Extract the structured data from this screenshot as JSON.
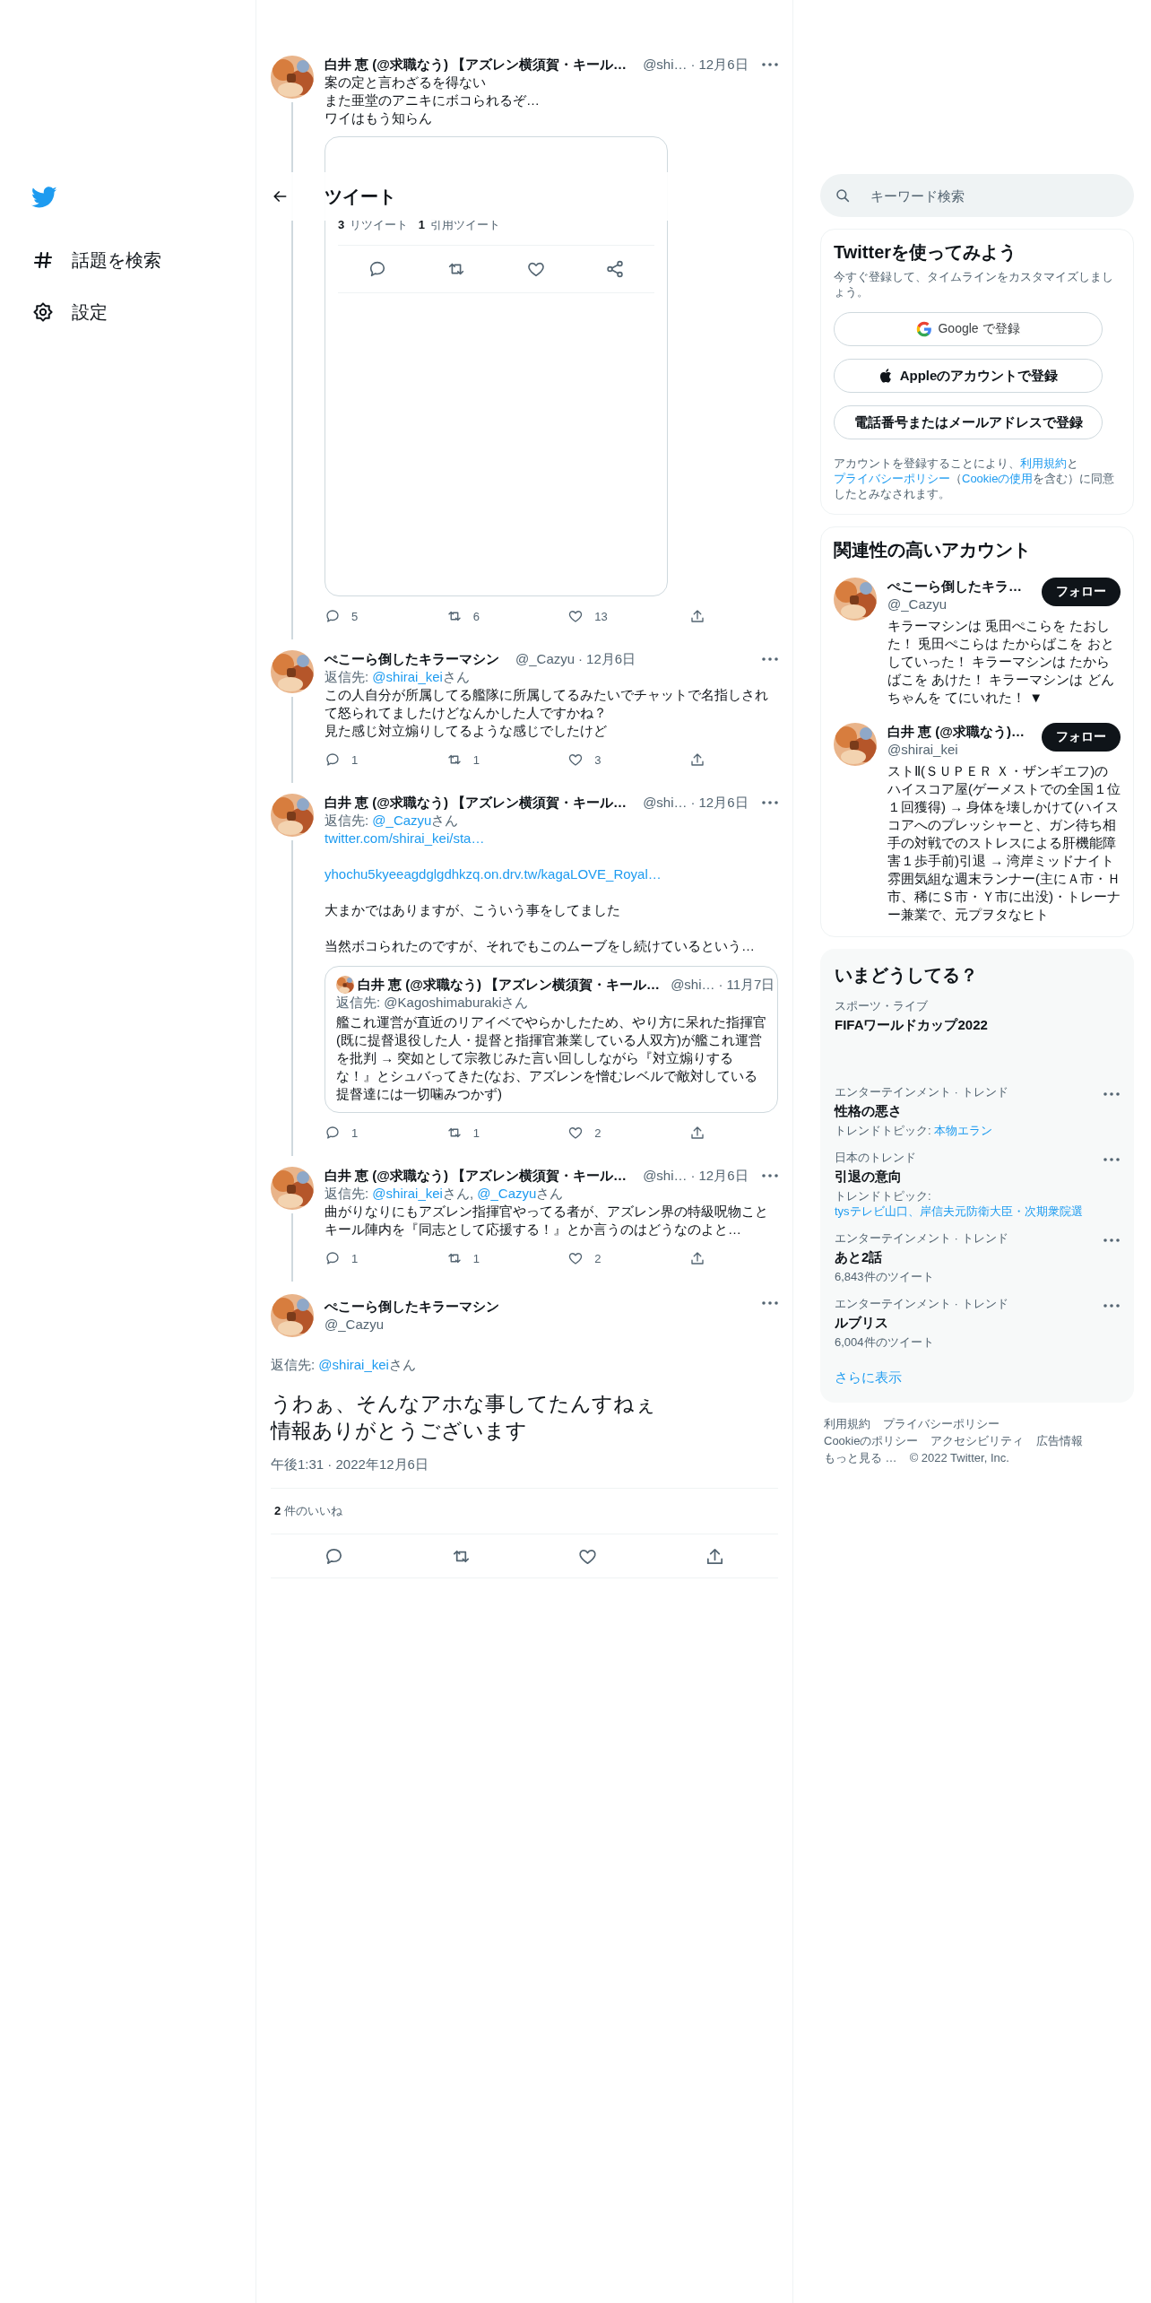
{
  "nav": {
    "items": [
      {
        "kind": "explore",
        "label": "話題を検索"
      },
      {
        "kind": "settings",
        "label": "設定"
      }
    ]
  },
  "header": {
    "title": "ツイート"
  },
  "thread": [
    {
      "name": "白井 恵 (@求職なう) 【アズレン横須賀・キール…",
      "handle": "@shi…",
      "dot": "·",
      "date": "12月6日",
      "body": [
        {
          "kind": "text",
          "lines": [
            "案の定と言わざるを得ない",
            "また亜堂のアニキにボコられるぞ…",
            "ワイはもう知らん"
          ]
        }
      ],
      "media": {
        "stats": [
          {
            "count": "3",
            "label": "リツイート"
          },
          {
            "count": "1",
            "label": "引用ツイート"
          }
        ]
      },
      "counts": {
        "reply": "5",
        "retweet": "6",
        "like": "13"
      }
    },
    {
      "name": "ぺこーら倒したキラーマシン",
      "handle": "@_Cazyu",
      "dot": "·",
      "date": "12月6日",
      "reply": [
        {
          "kind": "text",
          "text": "返信先: "
        },
        {
          "kind": "link",
          "text": "@shirai_kei"
        },
        {
          "kind": "text",
          "text": "さん"
        }
      ],
      "body": [
        {
          "kind": "text",
          "lines": [
            "この人自分が所属してる艦隊に所属してるみたいでチャットで名指しされて怒られてましたけどなんかした人ですかね？",
            "見た感じ対立煽りしてるような感じでしたけど"
          ]
        }
      ],
      "counts": {
        "reply": "1",
        "retweet": "1",
        "like": "3"
      }
    },
    {
      "name": "白井 恵 (@求職なう) 【アズレン横須賀・キール…",
      "handle": "@shi…",
      "dot": "·",
      "date": "12月6日",
      "reply": [
        {
          "kind": "text",
          "text": "返信先: "
        },
        {
          "kind": "link",
          "text": "@_Cazyu"
        },
        {
          "kind": "text",
          "text": "さん"
        }
      ],
      "body": [
        {
          "kind": "link",
          "lines": [
            "twitter.com/shirai_kei/sta…"
          ]
        },
        {
          "kind": "link",
          "lines": [
            "yhochu5kyeeagdglgdhkzq.on.drv.tw/kagaLOVE_Royal…"
          ]
        },
        {
          "kind": "text",
          "lines": [
            "大まかではありますが、こういう事をしてました"
          ]
        },
        {
          "kind": "text",
          "lines": [
            "当然ボコられたのですが、それでもこのムーブをし続けているという…"
          ]
        }
      ],
      "quote": {
        "name": "白井 恵 (@求職なう) 【アズレン横須賀・キール…",
        "handle": "@shi…",
        "dot": "·",
        "date": "11月7日",
        "reply": "返信先: @Kagoshimaburakiさん",
        "text": "艦これ運営が直近のリアイベでやらかしたため、やり方に呆れた指揮官(既に提督退役した人・提督と指揮官兼業している人双方)が艦これ運営を批判 → 突如として宗教じみた言い回ししながら『対立煽りするな！』とシュバってきた(なお、アズレンを憎むレベルで敵対している提督達には一切噛みつかず)"
      },
      "counts": {
        "reply": "1",
        "retweet": "1",
        "like": "2"
      }
    },
    {
      "name": "白井 恵 (@求職なう) 【アズレン横須賀・キール…",
      "handle": "@shi…",
      "dot": "·",
      "date": "12月6日",
      "reply": [
        {
          "kind": "text",
          "text": "返信先: "
        },
        {
          "kind": "link",
          "text": "@shirai_kei"
        },
        {
          "kind": "text",
          "text": "さん, "
        },
        {
          "kind": "link",
          "text": "@_Cazyu"
        },
        {
          "kind": "text",
          "text": "さん"
        }
      ],
      "body": [
        {
          "kind": "text",
          "lines": [
            "曲がりなりにもアズレン指揮官やってる者が、アズレン界の特級呪物ことキール陣内を『同志として応援する！』とか言うのはどうなのよと…"
          ]
        }
      ],
      "counts": {
        "reply": "1",
        "retweet": "1",
        "like": "2"
      }
    }
  ],
  "focus": {
    "name": "ぺこーら倒したキラーマシン",
    "handle": "@_Cazyu",
    "reply": [
      {
        "kind": "text",
        "text": "返信先: "
      },
      {
        "kind": "link",
        "text": "@shirai_kei"
      },
      {
        "kind": "text",
        "text": "さん"
      }
    ],
    "lines": [
      "うわぁ、そんなアホな事してたんすねぇ",
      "情報ありがとうございます"
    ],
    "time": "午後1:31 · 2022年12月6日",
    "likes": {
      "count": "2",
      "label": "件のいいね"
    }
  },
  "search": {
    "placeholder": "キーワード検索"
  },
  "signup": {
    "title": "Twitterを使ってみよう",
    "subtitle": "今すぐ登録して、タイムラインをカスタマイズしましょう。",
    "buttons": [
      {
        "kind": "google",
        "label": "Google で登録"
      },
      {
        "kind": "apple",
        "label": "Appleのアカウントで登録"
      },
      {
        "kind": "phone",
        "label": "電話番号またはメールアドレスで登録"
      }
    ],
    "legal": [
      {
        "kind": "text",
        "text": "アカウントを登録することにより、"
      },
      {
        "kind": "link",
        "text": "利用規約"
      },
      {
        "kind": "text",
        "text": "と"
      },
      {
        "kind": "link",
        "text": "プライバシーポリシー"
      },
      {
        "kind": "text",
        "text": "（"
      },
      {
        "kind": "link",
        "text": "Cookieの使用"
      },
      {
        "kind": "text",
        "text": "を含む）に同意したとみなされます。"
      }
    ]
  },
  "follow": {
    "title": "関連性の高いアカウント",
    "accounts": [
      {
        "name": "ぺこーら倒したキラ…",
        "handle": "@_Cazyu",
        "button": "フォロー",
        "bio": "キラーマシンは 兎田ぺこらを たおした！ 兎田ぺこらは たからばこを おとしていった！ キラーマシンは たからばこを あけた！ キラーマシンは どんちゃんを てにいれた！ ▼"
      },
      {
        "name": "白井 恵 (@求職なう)…",
        "handle": "@shirai_kei",
        "button": "フォロー",
        "bio": "ストⅡ(ＳＵＰＥＲ Ｘ・ザンギエフ)のハイスコア屋(ゲーメストでの全国１位１回獲得) → 身体を壊しかけて(ハイスコアへのプレッシャーと、ガン待ち相手の対戦でのストレスによる肝機能障害１歩手前)引退 → 湾岸ミッドナイト雰囲気組な週末ランナー(主にＡ市・Ｈ市、稀にＳ市・Ｙ市に出没)・トレーナー兼業で、元プヲタなヒト"
      }
    ]
  },
  "trends": {
    "title": "いまどうしてる？",
    "items": [
      {
        "category": "スポーツ・ライブ",
        "title": "FIFAワールドカップ2022",
        "menu": false
      },
      {
        "category": "エンターテインメント · トレンド",
        "title": "性格の悪さ",
        "meta": [
          {
            "kind": "text",
            "text": "トレンドトピック: "
          },
          {
            "kind": "link",
            "text": "本物エラン"
          }
        ],
        "menu": true
      },
      {
        "category": "日本のトレンド",
        "title": "引退の意向",
        "meta": [
          {
            "kind": "text",
            "text": "トレンドトピック: "
          },
          {
            "kind": "link",
            "text": "tysテレビ山口、岸信夫元防衛大臣・次期衆院選"
          }
        ],
        "menu": true
      },
      {
        "category": "エンターテインメント · トレンド",
        "title": "あと2話",
        "meta": [
          {
            "kind": "text",
            "text": "6,843件のツイート"
          }
        ],
        "menu": true
      },
      {
        "category": "エンターテインメント · トレンド",
        "title": "ルブリス",
        "meta": [
          {
            "kind": "text",
            "text": "6,004件のツイート"
          }
        ],
        "menu": true
      }
    ],
    "more": "さらに表示"
  },
  "footer": {
    "lines": [
      [
        "利用規約",
        "プライバシーポリシー"
      ],
      [
        "Cookieのポリシー",
        "アクセシビリティ",
        "広告情報"
      ],
      [
        "もっと見る …",
        "© 2022 Twitter, Inc."
      ]
    ]
  }
}
